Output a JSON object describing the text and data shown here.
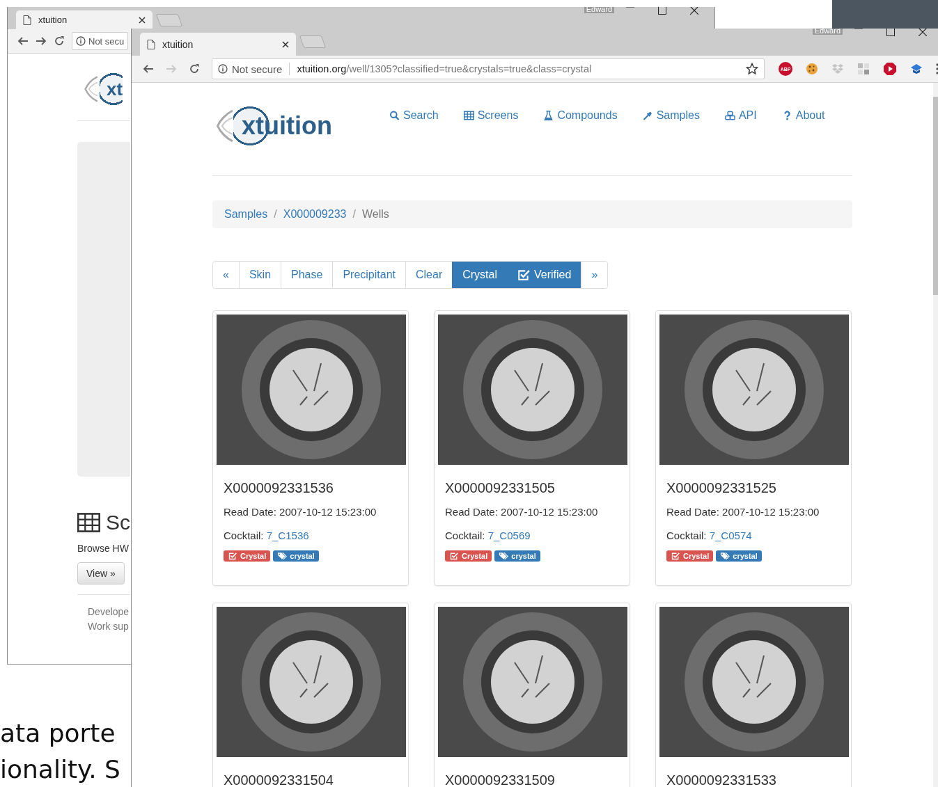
{
  "slide_lines": [
    "ata porte",
    "ionality. S"
  ],
  "back_window": {
    "tab_title": "xtuition",
    "user": "Edward",
    "security": "Not secu",
    "logo_text": "xt",
    "section_title": "Sc",
    "section_text": "Browse HW",
    "view_button": "View »",
    "footer_lines": [
      "Develope",
      "Work sup"
    ]
  },
  "front_window": {
    "tab_title": "xtuition",
    "user": "Edward",
    "security": "Not secure",
    "url_host": "xtuition.org",
    "url_path": "/well/1305?classified=true&crystals=true&class=crystal",
    "adblock_label": "ABP",
    "logo_text": "xtuition",
    "nav": [
      {
        "label": "Search",
        "kind": "search"
      },
      {
        "label": "Screens",
        "kind": "table"
      },
      {
        "label": "Compounds",
        "kind": "flask"
      },
      {
        "label": "Samples",
        "kind": "dropper"
      },
      {
        "label": "API",
        "kind": "cubes"
      },
      {
        "label": "About",
        "kind": "question"
      }
    ],
    "breadcrumb": {
      "separator": "/",
      "items": [
        {
          "label": "Samples",
          "current": false
        },
        {
          "label": "X000009233",
          "current": false
        },
        {
          "label": "Wells",
          "current": true
        }
      ]
    },
    "filters": [
      {
        "label": "«",
        "kind": "text",
        "selected": false
      },
      {
        "label": "Skin",
        "kind": "text",
        "selected": false
      },
      {
        "label": "Phase",
        "kind": "text",
        "selected": false
      },
      {
        "label": "Precipitant",
        "kind": "text",
        "selected": false
      },
      {
        "label": "Clear",
        "kind": "text",
        "selected": false
      },
      {
        "label": "Crystal",
        "kind": "text",
        "selected": true
      },
      {
        "label": "Verified",
        "kind": "check",
        "selected": true
      },
      {
        "label": "»",
        "kind": "text",
        "selected": false
      }
    ],
    "wells": [
      {
        "id": "X0000092331536",
        "read_date": "Read Date: 2007-10-12 15:23:00",
        "cocktail_label": "Cocktail:",
        "cocktail": "7_C1536",
        "tags": [
          {
            "label": "Crystal",
            "kind": "check",
            "color": "#d9534f"
          },
          {
            "label": "crystal",
            "kind": "tag",
            "color": "#337ab7"
          }
        ]
      },
      {
        "id": "X0000092331505",
        "read_date": "Read Date: 2007-10-12 15:23:00",
        "cocktail_label": "Cocktail:",
        "cocktail": "7_C0569",
        "tags": [
          {
            "label": "Crystal",
            "kind": "check",
            "color": "#d9534f"
          },
          {
            "label": "crystal",
            "kind": "tag",
            "color": "#337ab7"
          }
        ]
      },
      {
        "id": "X0000092331525",
        "read_date": "Read Date: 2007-10-12 15:23:00",
        "cocktail_label": "Cocktail:",
        "cocktail": "7_C0574",
        "tags": [
          {
            "label": "Crystal",
            "kind": "check",
            "color": "#d9534f"
          },
          {
            "label": "crystal",
            "kind": "tag",
            "color": "#337ab7"
          }
        ]
      },
      {
        "id": "X0000092331504"
      },
      {
        "id": "X0000092331509"
      },
      {
        "id": "X0000092331533"
      }
    ]
  }
}
